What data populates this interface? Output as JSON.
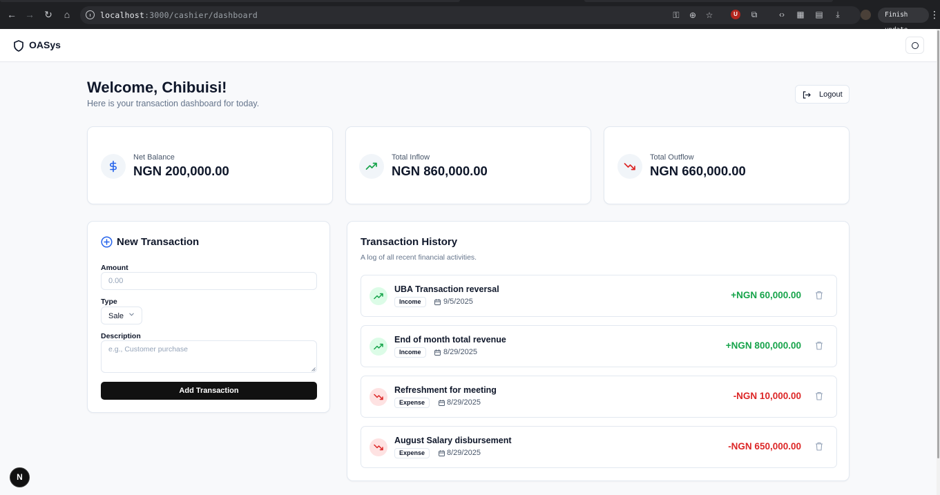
{
  "browser": {
    "url_host": "localhost",
    "url_path": ":3000/cashier/dashboard",
    "update_label": "Finish update"
  },
  "app": {
    "brand": "OASys"
  },
  "welcome": {
    "title": "Welcome, Chibuisi!",
    "subtitle": "Here is your transaction dashboard for today.",
    "logout_label": "Logout"
  },
  "stats": [
    {
      "label": "Net Balance",
      "value": "NGN 200,000.00",
      "icon": "dollar-icon",
      "color": "#2563eb"
    },
    {
      "label": "Total Inflow",
      "value": "NGN 860,000.00",
      "icon": "trending-up-icon",
      "color": "#16a34a"
    },
    {
      "label": "Total Outflow",
      "value": "NGN 660,000.00",
      "icon": "trending-down-icon",
      "color": "#dc2626"
    }
  ],
  "form": {
    "title": "New Transaction",
    "amount_label": "Amount",
    "amount_placeholder": "0.00",
    "type_label": "Type",
    "type_value": "Sale",
    "description_label": "Description",
    "description_placeholder": "e.g., Customer purchase",
    "submit_label": "Add Transaction"
  },
  "history": {
    "title": "Transaction History",
    "subtitle": "A log of all recent financial activities.",
    "items": [
      {
        "name": "UBA Transaction reversal",
        "type": "Income",
        "date": "9/5/2025",
        "amount": "+NGN 60,000.00",
        "direction": "in"
      },
      {
        "name": "End of month total revenue",
        "type": "Income",
        "date": "8/29/2025",
        "amount": "+NGN 800,000.00",
        "direction": "in"
      },
      {
        "name": "Refreshment for meeting",
        "type": "Expense",
        "date": "8/29/2025",
        "amount": "-NGN 10,000.00",
        "direction": "out"
      },
      {
        "name": "August Salary disbursement",
        "type": "Expense",
        "date": "8/29/2025",
        "amount": "-NGN 650,000.00",
        "direction": "out"
      }
    ]
  },
  "colors": {
    "income": "#16a34a",
    "expense": "#dc2626",
    "accent": "#2563eb"
  },
  "dev_badge": "N"
}
